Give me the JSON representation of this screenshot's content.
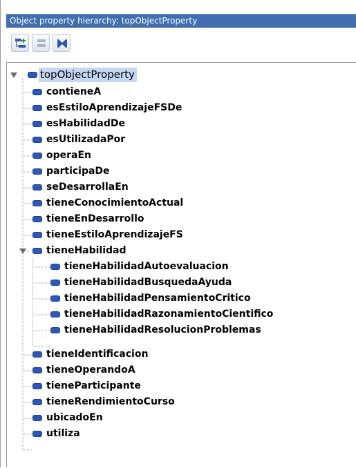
{
  "panel": {
    "title": "Object property hierarchy: topObjectProperty"
  },
  "toolbar": {
    "buttons": [
      {
        "icon": "add-sub-property-icon"
      },
      {
        "icon": "add-sibling-property-icon"
      },
      {
        "icon": "delete-property-icon"
      }
    ]
  },
  "tree": {
    "root": "topObjectProperty",
    "children": [
      "contieneA",
      "esEstiloAprendizajeFSDe",
      "esHabilidadDe",
      "esUtilizadaPor",
      "operaEn",
      "participaDe",
      "seDesarrollaEn",
      "tieneConocimientoActual",
      "tieneEnDesarrollo",
      "tieneEstiloAprendizajeFS",
      "tieneHabilidad",
      "tieneIdentificacion",
      "tieneOperandoA",
      "tieneParticipante",
      "tieneRendimientoCurso",
      "ubicadoEn",
      "utiliza"
    ],
    "tieneHabilidad_children": [
      "tieneHabilidadAutoevaluacion",
      "tieneHabilidadBusquedaAyuda",
      "tieneHabilidadPensamientoCritico",
      "tieneHabilidadRazonamientoCientifico",
      "tieneHabilidadResolucionProblemas"
    ]
  },
  "colors": {
    "title_bar": "#3f6fb0",
    "property_icon": "#2d57b6",
    "selection": "#c5d6f2"
  }
}
